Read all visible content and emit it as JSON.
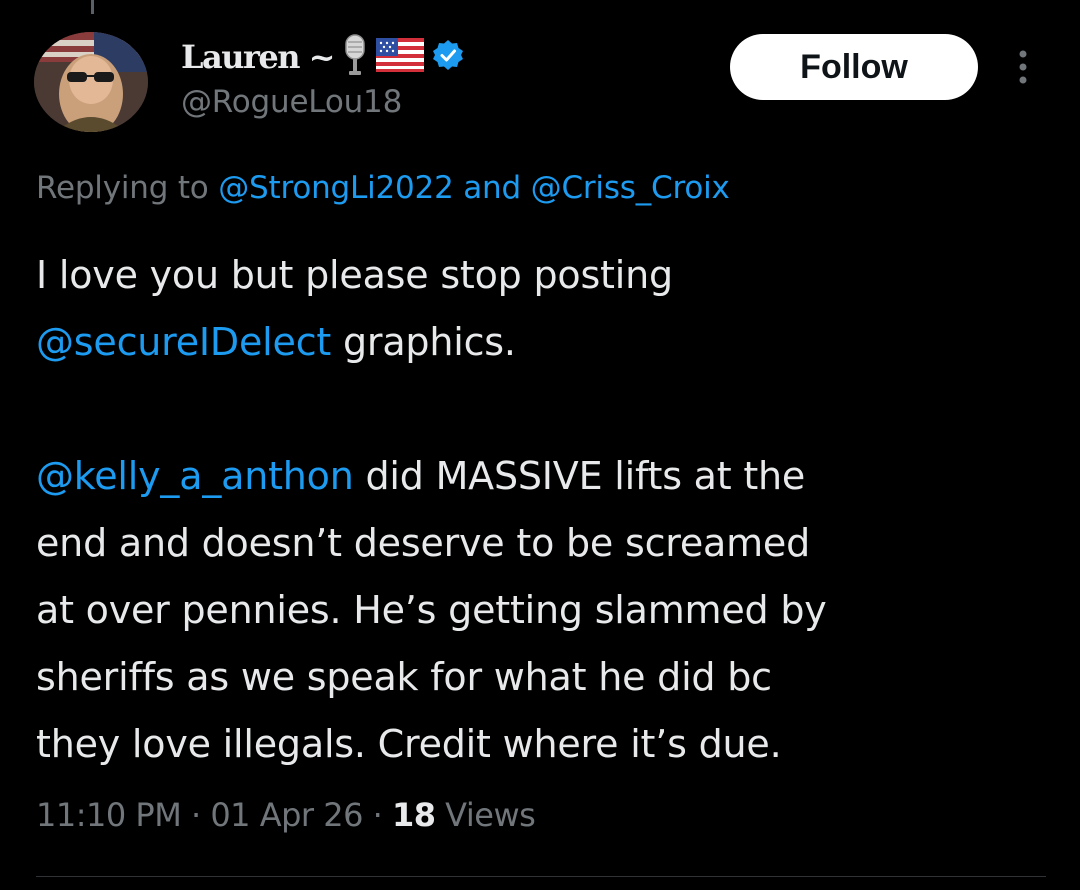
{
  "author": {
    "display_name": "Lauren ~",
    "handle": "@RogueLou18",
    "badge_icons": [
      "microphone-icon",
      "us-flag-icon",
      "verified-badge-icon"
    ]
  },
  "follow_label": "Follow",
  "reply_context": {
    "prefix": "Replying to ",
    "mention_1": "@StrongLi2022",
    "separator": " and ",
    "mention_2": "@Criss_Croix"
  },
  "tweet": {
    "line1": "I love you but please stop posting",
    "line2_mention": "@secureIDelect",
    "line2_text": " graphics.",
    "line3_mention": "@kelly_a_anthon",
    "line3_text": " did MASSIVE lifts at the",
    "line4": "end and doesn’t deserve to be screamed",
    "line5": "at over pennies. He’s getting slammed by",
    "line6": "sheriffs as we speak for what he did bc",
    "line7": "they love illegals. Credit where it’s due."
  },
  "meta": {
    "time": "11:10 PM",
    "dot1": " · ",
    "date": "01 Apr 26",
    "dot2": " · ",
    "views_count": "18",
    "views_label": " Views"
  },
  "colors": {
    "background": "#000000",
    "text": "#e7e9ea",
    "muted": "#71767b",
    "link": "#1d9bf0",
    "button_bg": "#ffffff"
  }
}
